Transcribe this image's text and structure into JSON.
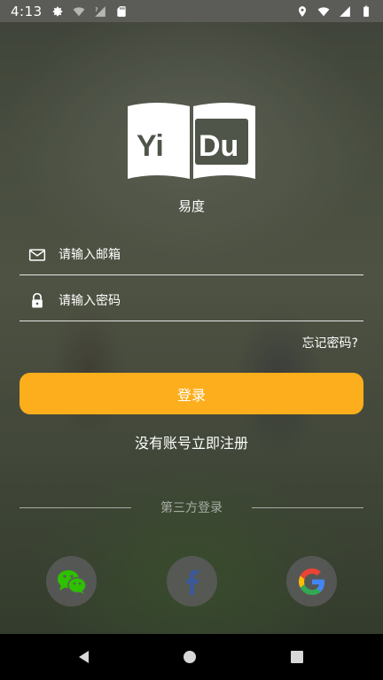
{
  "status_bar": {
    "time": "4:13",
    "icons_left": [
      "gear-icon",
      "wifi-off-icon",
      "signal-unknown-icon",
      "sd-card-icon"
    ],
    "icons_right": [
      "location-icon",
      "wifi-icon",
      "signal-icon",
      "battery-icon"
    ]
  },
  "logo": {
    "text_left": "Yi",
    "text_right": "Du"
  },
  "app_name": "易度",
  "form": {
    "email_placeholder": "请输入邮箱",
    "password_placeholder": "请输入密码",
    "forgot_password": "忘记密码?",
    "login_label": "登录",
    "register_label": "没有账号立即注册"
  },
  "third_party": {
    "label": "第三方登录",
    "providers": [
      "wechat-icon",
      "facebook-icon",
      "google-icon"
    ]
  },
  "colors": {
    "accent": "#fdae1c",
    "statusbar": "#5b5b58",
    "facebook_blue": "#3b5998",
    "wechat_green": "#2dc100"
  }
}
